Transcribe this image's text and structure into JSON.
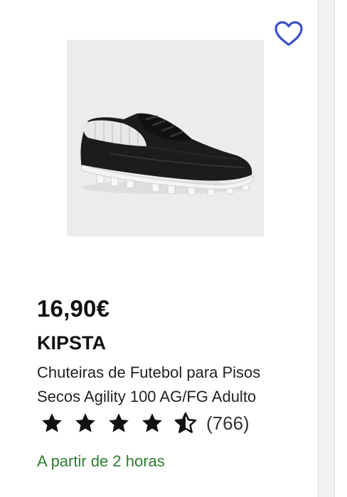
{
  "product": {
    "price": "16,90€",
    "brand": "KIPSTA",
    "title": "Chuteiras de Futebol para Pisos Secos Agility 100 AG/FG Adulto",
    "rating": 4.5,
    "review_count": "(766)",
    "availability": "A partir de 2 horas",
    "wishlist_icon": "heart-outline-icon",
    "image": "black-football-boot-image"
  },
  "colors": {
    "heart": "#3b4fc9",
    "availability": "#2e7d32",
    "stars": "#111111"
  }
}
